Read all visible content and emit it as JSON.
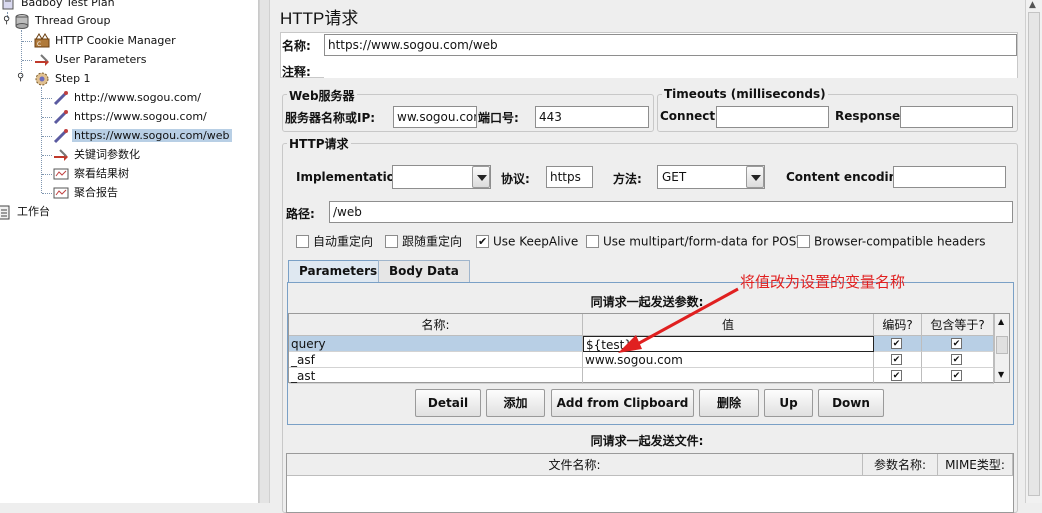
{
  "tree": {
    "items": [
      {
        "label": "Badboy Test Plan",
        "icon": "test-plan-icon"
      },
      {
        "label": "Thread Group",
        "icon": "thread-group-icon"
      },
      {
        "label": "HTTP Cookie Manager",
        "icon": "cookie-manager-icon"
      },
      {
        "label": "User Parameters",
        "icon": "user-parameters-icon"
      },
      {
        "label": "Step 1",
        "icon": "step-gear-icon"
      },
      {
        "label": "http://www.sogou.com/",
        "icon": "sampler-pipette-icon"
      },
      {
        "label": "https://www.sogou.com/",
        "icon": "sampler-pipette-icon"
      },
      {
        "label": "https://www.sogou.com/web",
        "icon": "sampler-pipette-icon"
      },
      {
        "label": "关键词参数化",
        "icon": "preprocessor-icon"
      },
      {
        "label": "察看结果树",
        "icon": "listener-icon"
      },
      {
        "label": "聚合报告",
        "icon": "listener-icon"
      },
      {
        "label": "工作台",
        "icon": "workbench-icon"
      }
    ]
  },
  "panel": {
    "title": "HTTP请求",
    "name_label": "名称:",
    "name_value": "https://www.sogou.com/web",
    "comment_label": "注释:",
    "web_server_legend": "Web服务器",
    "server_label": "服务器名称或IP:",
    "server_value": "ww.sogou.com",
    "port_label": "端口号:",
    "port_value": "443",
    "timeouts_legend": "Timeouts (milliseconds)",
    "connect_label": "Connect:",
    "connect_value": "",
    "response_label": "Response:",
    "response_value": "",
    "http_legend": "HTTP请求",
    "impl_label": "Implementation:",
    "impl_value": "",
    "protocol_label": "协议:",
    "protocol_value": "https",
    "method_label": "方法:",
    "method_value": "GET",
    "encoding_label": "Content encoding:",
    "encoding_value": "",
    "path_label": "路径:",
    "path_value": "/web",
    "checkboxes": [
      {
        "label": "自动重定向",
        "checked": false
      },
      {
        "label": "跟随重定向",
        "checked": false
      },
      {
        "label": "Use KeepAlive",
        "checked": true
      },
      {
        "label": "Use multipart/form-data for POST",
        "checked": false
      },
      {
        "label": "Browser-compatible headers",
        "checked": false
      }
    ],
    "tabs": [
      "Parameters",
      "Body Data"
    ],
    "params_title": "同请求一起发送参数:",
    "params_columns": [
      "名称:",
      "值",
      "编码?",
      "包含等于?"
    ],
    "params_rows": [
      {
        "name": "query",
        "value": "${test}",
        "encode": true,
        "include_equals": true
      },
      {
        "name": "_asf",
        "value": "www.sogou.com",
        "encode": true,
        "include_equals": true
      },
      {
        "name": "_ast",
        "value": "",
        "encode": true,
        "include_equals": true
      }
    ],
    "buttons": [
      "Detail",
      "添加",
      "Add from Clipboard",
      "删除",
      "Up",
      "Down"
    ],
    "files_title": "同请求一起发送文件:",
    "files_columns": [
      "文件名称:",
      "参数名称:",
      "MIME类型:"
    ]
  },
  "annotation": "将值改为设置的变量名称",
  "colors": {
    "annotation": "#e02020",
    "selection": "#b8cfe5"
  }
}
